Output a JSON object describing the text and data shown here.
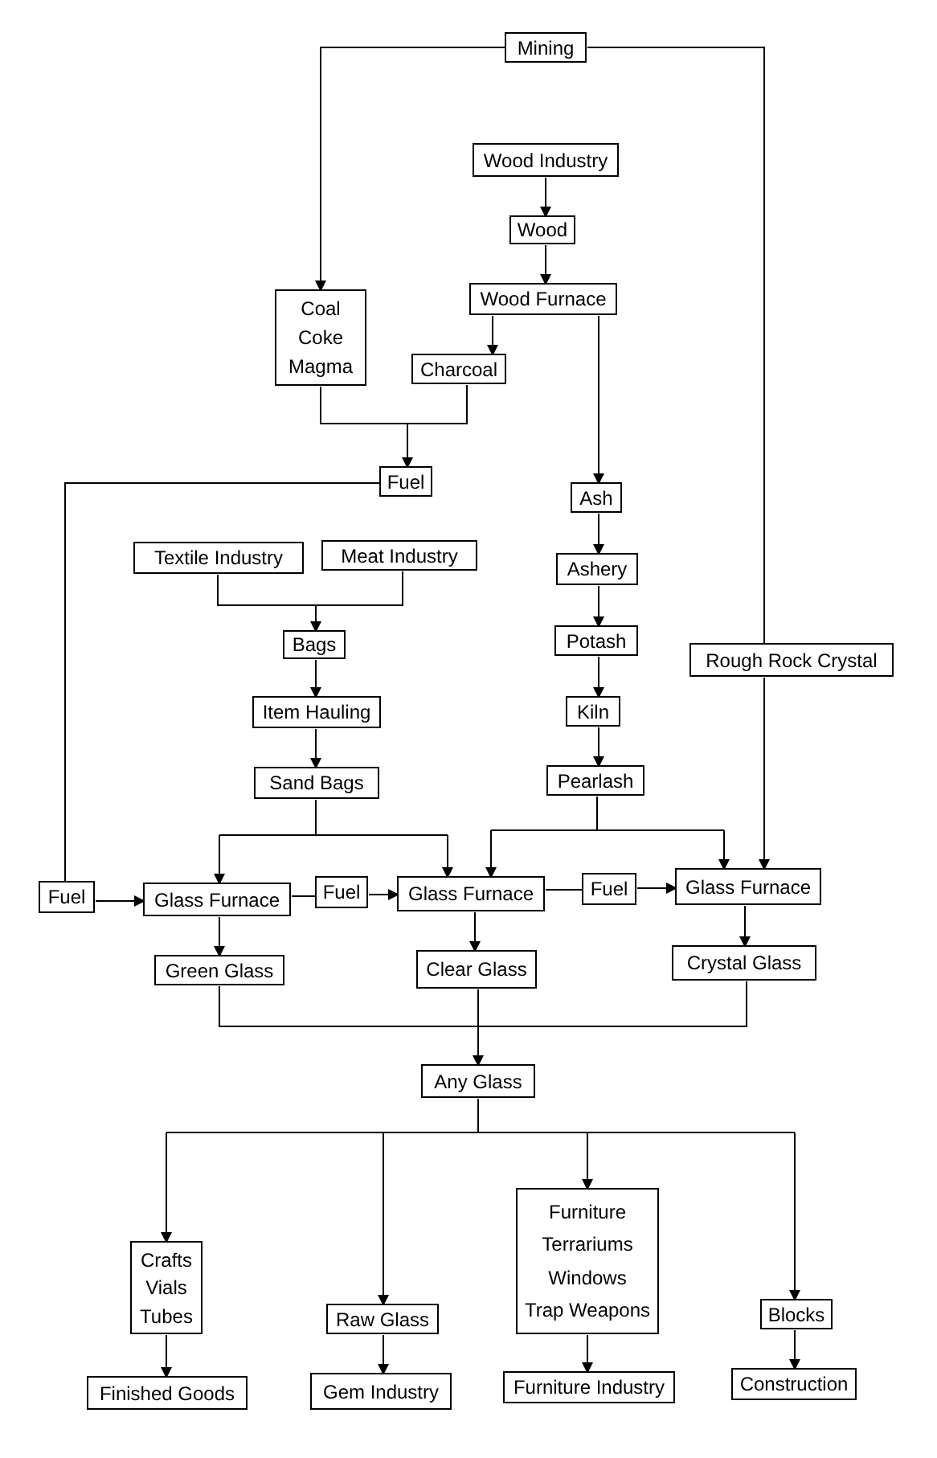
{
  "nodes": [
    {
      "lines": [
        "Mining"
      ]
    },
    {
      "lines": [
        "Wood Industry"
      ]
    },
    {
      "lines": [
        "Wood"
      ]
    },
    {
      "lines": [
        "Wood Furnace"
      ]
    },
    {
      "lines": [
        "Coal",
        "Coke",
        "Magma"
      ]
    },
    {
      "lines": [
        "Charcoal"
      ]
    },
    {
      "lines": [
        "Fuel"
      ]
    },
    {
      "lines": [
        "Ash"
      ]
    },
    {
      "lines": [
        "Textile Industry"
      ]
    },
    {
      "lines": [
        "Meat Industry"
      ]
    },
    {
      "lines": [
        "Ashery"
      ]
    },
    {
      "lines": [
        "Rough Rock Crystal"
      ]
    },
    {
      "lines": [
        "Bags"
      ]
    },
    {
      "lines": [
        "Potash"
      ]
    },
    {
      "lines": [
        "Item Hauling"
      ]
    },
    {
      "lines": [
        "Kiln"
      ]
    },
    {
      "lines": [
        "Sand Bags"
      ]
    },
    {
      "lines": [
        "Pearlash"
      ]
    },
    {
      "lines": [
        "Fuel"
      ]
    },
    {
      "lines": [
        "Glass Furnace"
      ]
    },
    {
      "lines": [
        "Fuel"
      ]
    },
    {
      "lines": [
        "Glass Furnace"
      ]
    },
    {
      "lines": [
        "Fuel"
      ]
    },
    {
      "lines": [
        "Glass Furnace"
      ]
    },
    {
      "lines": [
        "Green Glass"
      ]
    },
    {
      "lines": [
        "Clear Glass"
      ]
    },
    {
      "lines": [
        "Crystal Glass"
      ]
    },
    {
      "lines": [
        "Any Glass"
      ]
    },
    {
      "lines": [
        "Crafts",
        "Vials",
        "Tubes"
      ]
    },
    {
      "lines": [
        "Raw Glass"
      ]
    },
    {
      "lines": [
        "Furniture",
        "Terrariums",
        "Windows",
        "Trap Weapons"
      ]
    },
    {
      "lines": [
        "Blocks"
      ]
    },
    {
      "lines": [
        "Finished Goods"
      ]
    },
    {
      "lines": [
        "Gem Industry"
      ]
    },
    {
      "lines": [
        "Furniture Industry"
      ]
    },
    {
      "lines": [
        "Construction"
      ]
    }
  ]
}
